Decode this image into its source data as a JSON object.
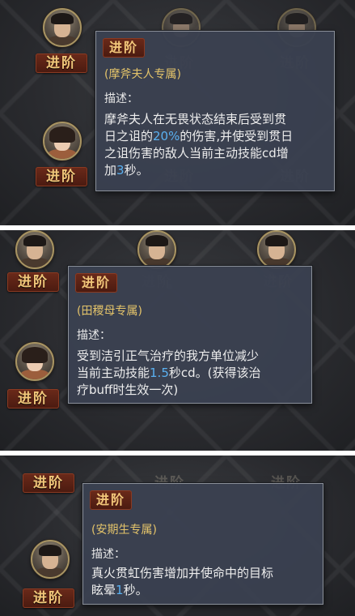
{
  "badge_label": "进阶",
  "panels": [
    {
      "tooltip": {
        "title": "进阶",
        "owner": "(摩斧夫人专属)",
        "desc_label": "描述：",
        "desc_line1": "摩斧夫人在无畏状态结束后受到贯",
        "desc_line2_a": "日之诅的",
        "desc_line2_hl": "20%",
        "desc_line2_b": "的伤害,并使受到贯日",
        "desc_line3": "之诅伤害的敌人当前主动技能cd增",
        "desc_line4_a": "加",
        "desc_line4_hl": "3",
        "desc_line4_b": "秒。"
      }
    },
    {
      "tooltip": {
        "title": "进阶",
        "owner": "(田稷母专属)",
        "desc_label": "描述：",
        "desc_line1": "受到洁引正气治疗的我方单位减少",
        "desc_line2_a": "当前主动技能",
        "desc_line2_hl": "1.5",
        "desc_line2_b": "秒cd。(获得该治",
        "desc_line3": "疗buff时生效一次)"
      }
    },
    {
      "tooltip": {
        "title": "进阶",
        "owner": "(安期生专属)",
        "desc_label": "描述：",
        "desc_line1": "真火贯虹伤害增加并使命中的目标",
        "desc_line2_a": "眩晕",
        "desc_line2_hl": "1",
        "desc_line2_b": "秒。"
      }
    }
  ]
}
